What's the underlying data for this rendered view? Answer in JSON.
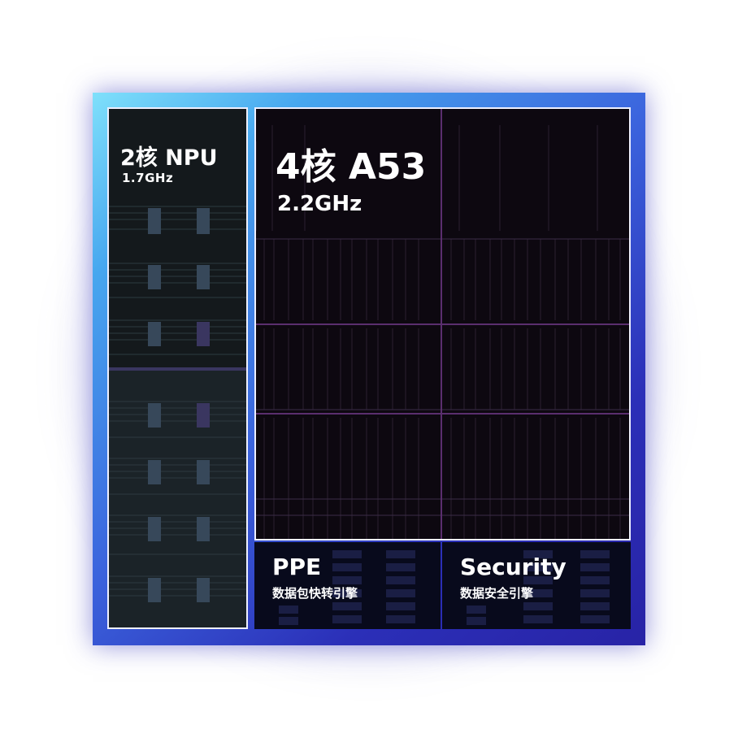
{
  "npu": {
    "title": "2核 NPU",
    "freq": "1.7GHz"
  },
  "cpu": {
    "title": "4核 A53",
    "freq": "2.2GHz"
  },
  "ppe": {
    "title": "PPE",
    "subtitle": "数据包快转引擎"
  },
  "security": {
    "title": "Security",
    "subtitle": "数据安全引擎"
  },
  "colors": {
    "chip_gradient_start": "#7fe0fb",
    "chip_gradient_end": "#2823a6",
    "block_border": "#eef0ff",
    "cpu_grid_accent": "#7a3b8c"
  }
}
